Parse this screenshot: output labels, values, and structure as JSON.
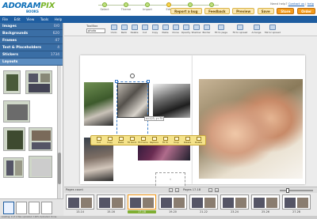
{
  "brand": {
    "name_part1": "ADORAM",
    "name_part2": "PIX",
    "subtitle": "BOOKS"
  },
  "steps": [
    {
      "label": "Select"
    },
    {
      "label": "Theme"
    },
    {
      "label": "Import"
    },
    {
      "label": "Edit"
    },
    {
      "label": "Preview"
    },
    {
      "label": "Order"
    }
  ],
  "toplinks": {
    "need_help": "Need help?",
    "contact": "Contact us",
    "help": "help"
  },
  "actions": {
    "report_bug": "Report a bug",
    "feedback": "Feedback",
    "preview": "Preview",
    "save": "Save",
    "store": "Store",
    "order": "Order"
  },
  "menu": [
    "File",
    "Edit",
    "View",
    "Tools",
    "Help"
  ],
  "sidebar": {
    "categories": [
      {
        "label": "Images",
        "count": "0/0"
      },
      {
        "label": "Backgrounds",
        "count": "620"
      },
      {
        "label": "Frames",
        "count": "47"
      },
      {
        "label": "Text & Placeholders",
        "count": "4"
      },
      {
        "label": "Stickers",
        "count": "1734"
      },
      {
        "label": "Layouts",
        "count": ""
      }
    ]
  },
  "toolbox": {
    "label": "ToolBox",
    "mode": "photo",
    "tools": [
      "Undo",
      "Redo",
      "Delete",
      "Cut",
      "Copy",
      "Paste",
      "Clone",
      "Opacity",
      "Shadow",
      "Border",
      "Fit to page",
      "Fit to spread",
      "Arrange",
      "Mirror spread"
    ]
  },
  "context_tools": [
    "Cut",
    "Copy",
    "Paste",
    "Fit block",
    "Fit frame",
    "Replace",
    "Fit To",
    "Crop",
    "Rotate",
    "Delete"
  ],
  "coordinate_readout": "x=123, y=75",
  "filmstrip": {
    "page_count_label": "Pages count",
    "page_selector": "Pages 17-18",
    "spreads": [
      {
        "label": "13-14"
      },
      {
        "label": "15-16"
      },
      {
        "label": "17-18"
      },
      {
        "label": "19-20"
      },
      {
        "label": "21-22"
      },
      {
        "label": "23-24"
      },
      {
        "label": "25-26"
      },
      {
        "label": "27-28"
      }
    ],
    "selected_index": 2
  },
  "status": "Loading: 0 of 1 files uploaded. 100% Uploaded. Done."
}
